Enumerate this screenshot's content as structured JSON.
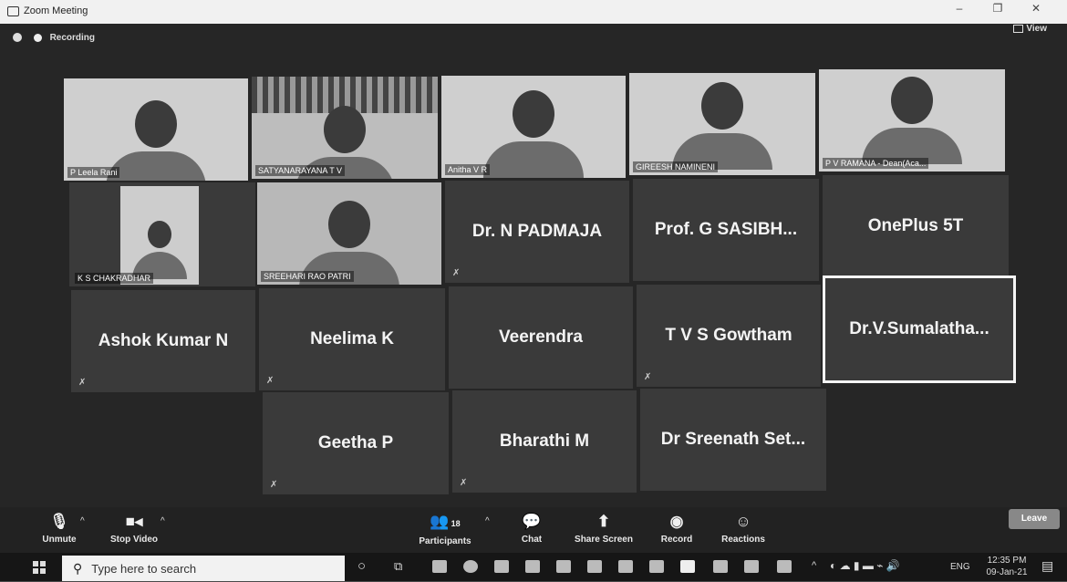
{
  "window": {
    "title": "Zoom Meeting",
    "minimize": "–",
    "maximize": "❐",
    "close": "✕"
  },
  "top": {
    "recording": "Recording",
    "view": "View"
  },
  "tiles": [
    {
      "name": "P Leela Rani"
    },
    {
      "name": "SATYANARAYANA T V"
    },
    {
      "name": "Anitha V R"
    },
    {
      "name": "GIREESH NAMINENI"
    },
    {
      "name": "P V RAMANA - Dean(Aca..."
    },
    {
      "name": "K S CHAKRADHAR"
    },
    {
      "name": "SREEHARI RAO PATRI"
    },
    {
      "name": "Dr. N PADMAJA"
    },
    {
      "name": "Prof.  G SASIBH..."
    },
    {
      "name": "OnePlus 5T"
    },
    {
      "name": "Ashok Kumar N"
    },
    {
      "name": "Neelima K"
    },
    {
      "name": "Veerendra"
    },
    {
      "name": "T V S Gowtham"
    },
    {
      "name": "Dr.V.Sumalatha..."
    },
    {
      "name": "Geetha P"
    },
    {
      "name": "Bharathi M"
    },
    {
      "name": "Dr Sreenath Set..."
    }
  ],
  "toolbar": {
    "unmute": "Unmute",
    "stop_video": "Stop Video",
    "participants": "Participants",
    "participants_count": "18",
    "chat": "Chat",
    "share_screen": "Share Screen",
    "record": "Record",
    "reactions": "Reactions",
    "leave": "Leave"
  },
  "taskbar": {
    "search_placeholder": "Type here to search",
    "language": "ENG",
    "time": "12:35 PM",
    "date": "09-Jan-21"
  }
}
